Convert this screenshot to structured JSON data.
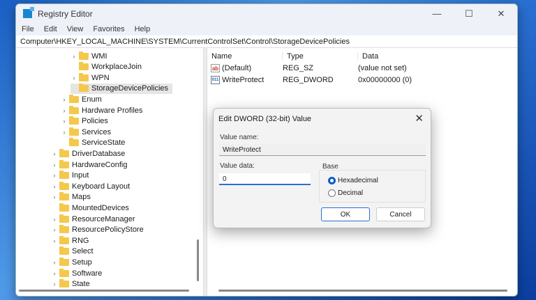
{
  "window": {
    "title": "Registry Editor",
    "minimize": "—",
    "maximize": "☐",
    "close": "✕"
  },
  "menu": [
    "File",
    "Edit",
    "View",
    "Favorites",
    "Help"
  ],
  "address": "Computer\\HKEY_LOCAL_MACHINE\\SYSTEM\\CurrentControlSet\\Control\\StorageDevicePolicies",
  "tree": [
    {
      "label": "WMI",
      "level": 3,
      "expand": true
    },
    {
      "label": "WorkplaceJoin",
      "level": 3,
      "expand": false
    },
    {
      "label": "WPN",
      "level": 3,
      "expand": true
    },
    {
      "label": "StorageDevicePolicies",
      "level": 3,
      "expand": false,
      "selected": true
    },
    {
      "label": "Enum",
      "level": 2,
      "expand": true
    },
    {
      "label": "Hardware Profiles",
      "level": 2,
      "expand": true
    },
    {
      "label": "Policies",
      "level": 2,
      "expand": true
    },
    {
      "label": "Services",
      "level": 2,
      "expand": true
    },
    {
      "label": "ServiceState",
      "level": 2,
      "expand": false
    },
    {
      "label": "DriverDatabase",
      "level": 1,
      "expand": true
    },
    {
      "label": "HardwareConfig",
      "level": 1,
      "expand": true
    },
    {
      "label": "Input",
      "level": 1,
      "expand": true
    },
    {
      "label": "Keyboard Layout",
      "level": 1,
      "expand": true
    },
    {
      "label": "Maps",
      "level": 1,
      "expand": true
    },
    {
      "label": "MountedDevices",
      "level": 1,
      "expand": false
    },
    {
      "label": "ResourceManager",
      "level": 1,
      "expand": true
    },
    {
      "label": "ResourcePolicyStore",
      "level": 1,
      "expand": true
    },
    {
      "label": "RNG",
      "level": 1,
      "expand": true
    },
    {
      "label": "Select",
      "level": 1,
      "expand": false
    },
    {
      "label": "Setup",
      "level": 1,
      "expand": true
    },
    {
      "label": "Software",
      "level": 1,
      "expand": true
    },
    {
      "label": "State",
      "level": 1,
      "expand": true
    }
  ],
  "list": {
    "headers": [
      "Name",
      "Type",
      "Data"
    ],
    "rows": [
      {
        "icon": "ab",
        "name": "(Default)",
        "type": "REG_SZ",
        "data": "(value not set)"
      },
      {
        "icon": "011",
        "name": "WriteProtect",
        "type": "REG_DWORD",
        "data": "0x00000000 (0)"
      }
    ]
  },
  "dialog": {
    "title": "Edit DWORD (32-bit) Value",
    "close": "✕",
    "value_name_label": "Value name:",
    "value_name": "WriteProtect",
    "value_data_label": "Value data:",
    "value_data": "0",
    "base_label": "Base",
    "hex": "Hexadecimal",
    "dec": "Decimal",
    "selected_base": "Hexadecimal",
    "ok": "OK",
    "cancel": "Cancel"
  }
}
